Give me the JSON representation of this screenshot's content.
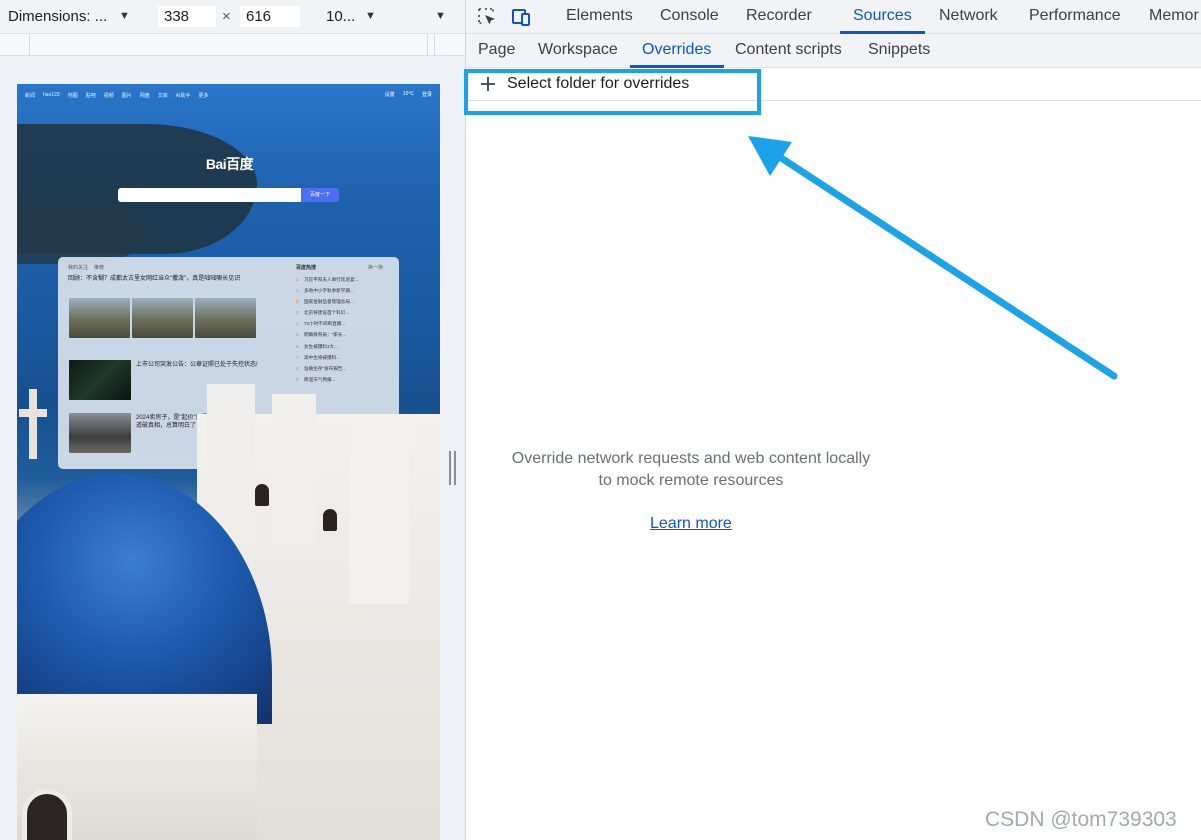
{
  "device_toolbar": {
    "dimensions_label": "Dimensions: ...",
    "width_value": "338",
    "times_glyph": "×",
    "height_value": "616",
    "zoom_label": "10..."
  },
  "devtools": {
    "main_tabs": [
      {
        "label": "Elements",
        "active": false
      },
      {
        "label": "Console",
        "active": false
      },
      {
        "label": "Recorder",
        "active": false
      },
      {
        "label": "Sources",
        "active": true
      },
      {
        "label": "Network",
        "active": false
      },
      {
        "label": "Performance",
        "active": false
      },
      {
        "label": "Memor",
        "active": false
      }
    ],
    "sub_tabs": [
      {
        "label": "Page",
        "active": false
      },
      {
        "label": "Workspace",
        "active": false
      },
      {
        "label": "Overrides",
        "active": true
      },
      {
        "label": "Content scripts",
        "active": false
      },
      {
        "label": "Snippets",
        "active": false
      }
    ],
    "select_folder_label": "Select folder for overrides",
    "empty_message_line1": "Override network requests and web content locally",
    "empty_message_line2": "to mock remote resources",
    "learn_more": "Learn more"
  },
  "page_preview": {
    "logo_text": "Bai百度",
    "search_button": "百度一下",
    "nav_items": [
      "新闻",
      "hao123",
      "地图",
      "贴吧",
      "视频",
      "图片",
      "网盘",
      "文库",
      "AI助手",
      "更多"
    ],
    "right_items": [
      "设置",
      "10℃",
      "登录"
    ],
    "card_tabs": [
      "我的关注",
      "推荐"
    ],
    "headline": "回顾：不含糊？成都太古里女网红当众\"撒泼\"，真是咄咄嘛长见识",
    "news": [
      {
        "title": "上市公司突发公告：公章证照已处于失控状态!"
      },
      {
        "title": "2024卖房子，是\"起价\"还是\"降\"？内行人一语道破真相，总算明白了"
      }
    ],
    "hot_title": "百度热搜",
    "hot_refresh": "换一换",
    "hot_list": [
      "习近平和夫人举行欢迎宴...",
      "多地中小学秋季新学期...",
      "国家金融监督管理总局...",
      "北京将建设首个科幻...",
      "72小时不间断直播...",
      "明确教育局：\"家长...",
      "女生被爆料3大...",
      "高中生将被爆料...",
      "准确生存\"发布报告...",
      "降温天气预报..."
    ]
  },
  "colors": {
    "accent_blue": "#0b57d0",
    "annotation_blue": "#1aa3e8"
  },
  "watermark": "CSDN @tom739303"
}
